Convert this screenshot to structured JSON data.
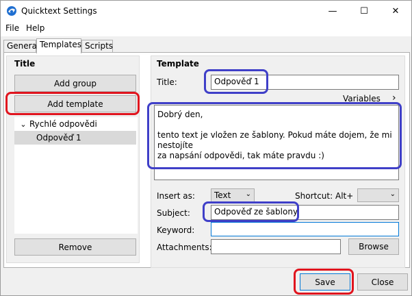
{
  "window": {
    "title": "Quicktext Settings",
    "controls": {
      "minimize": "—",
      "maximize": "☐",
      "close": "✕"
    }
  },
  "menu": [
    "File",
    "Help"
  ],
  "tabs": [
    {
      "label": "General",
      "active": false
    },
    {
      "label": "Templates",
      "active": true
    },
    {
      "label": "Scripts",
      "active": false
    }
  ],
  "left": {
    "title": "Title",
    "add_group": "Add group",
    "add_template": "Add template",
    "tree": {
      "group": "Rychlé odpovědi",
      "expander": "⌄",
      "item": "Odpověď 1"
    },
    "remove": "Remove"
  },
  "template": {
    "title": "Template",
    "title_label": "Title:",
    "title_value": "Odpověď 1",
    "variables": "Variables",
    "variables_arrow": "›",
    "body_line1": "Dobrý den,",
    "body_line2": "tento text je vložen ze šablony. Pokud máte dojem, že mi nestojíte",
    "body_line3": "za napsání odpovědi, tak máte pravdu :)",
    "insert_as_label": "Insert as:",
    "insert_as_value": "Text",
    "shortcut_label": "Shortcut:",
    "shortcut_mod": "Alt+",
    "shortcut_value": "",
    "subject_label": "Subject:",
    "subject_value": "Odpověď ze šablony",
    "keyword_label": "Keyword:",
    "keyword_value": "",
    "attachments_label": "Attachments:",
    "attachments_value": "",
    "browse": "Browse"
  },
  "footer": {
    "save": "Save",
    "close": "Close"
  },
  "colors": {
    "highlight_red": "#e0141e",
    "highlight_blue": "#3f3fc8",
    "focus_blue": "#0078d7"
  }
}
